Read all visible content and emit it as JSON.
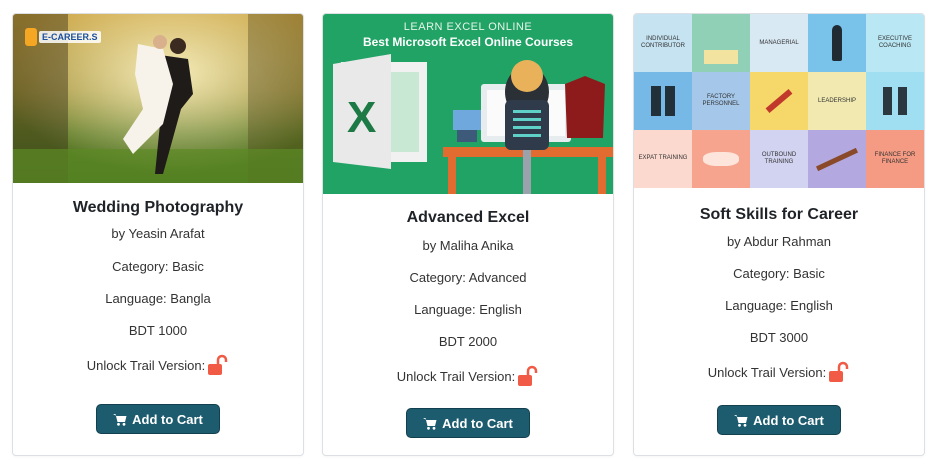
{
  "courses": [
    {
      "title": "Wedding Photography",
      "author": "by Yeasin Arafat",
      "category": "Category: Basic",
      "language": "Language: Bangla",
      "price": "BDT 1000",
      "unlock": "Unlock Trail Version:",
      "cart": "Add to Cart",
      "logo_text": "E-CAREER.S"
    },
    {
      "title": "Advanced Excel",
      "author": "by Maliha Anika",
      "category": "Category: Advanced",
      "language": "Language: English",
      "price": "BDT 2000",
      "unlock": "Unlock Trail Version:",
      "cart": "Add to Cart",
      "banner_small": "LEARN EXCEL ONLINE",
      "banner_big": "Best Microsoft Excel Online Courses"
    },
    {
      "title": "Soft Skills for Career",
      "author": "by Abdur Rahman",
      "category": "Category: Basic",
      "language": "Language: English",
      "price": "BDT 3000",
      "unlock": "Unlock Trail Version:",
      "cart": "Add to Cart",
      "tiles": [
        "INDIVIDUAL CONTRIBUTOR",
        "MANAGERIAL",
        "EXECUTIVE COACHING",
        "FACTORY PERSONNEL",
        "LEADERSHIP",
        "EXPAT TRAINING",
        "OUTBOUND TRAINING",
        "FINANCE FOR FINANCE"
      ]
    }
  ],
  "colors": {
    "button": "#1d5b6e",
    "lock": "#f15a45",
    "excel_green": "#21a366"
  }
}
